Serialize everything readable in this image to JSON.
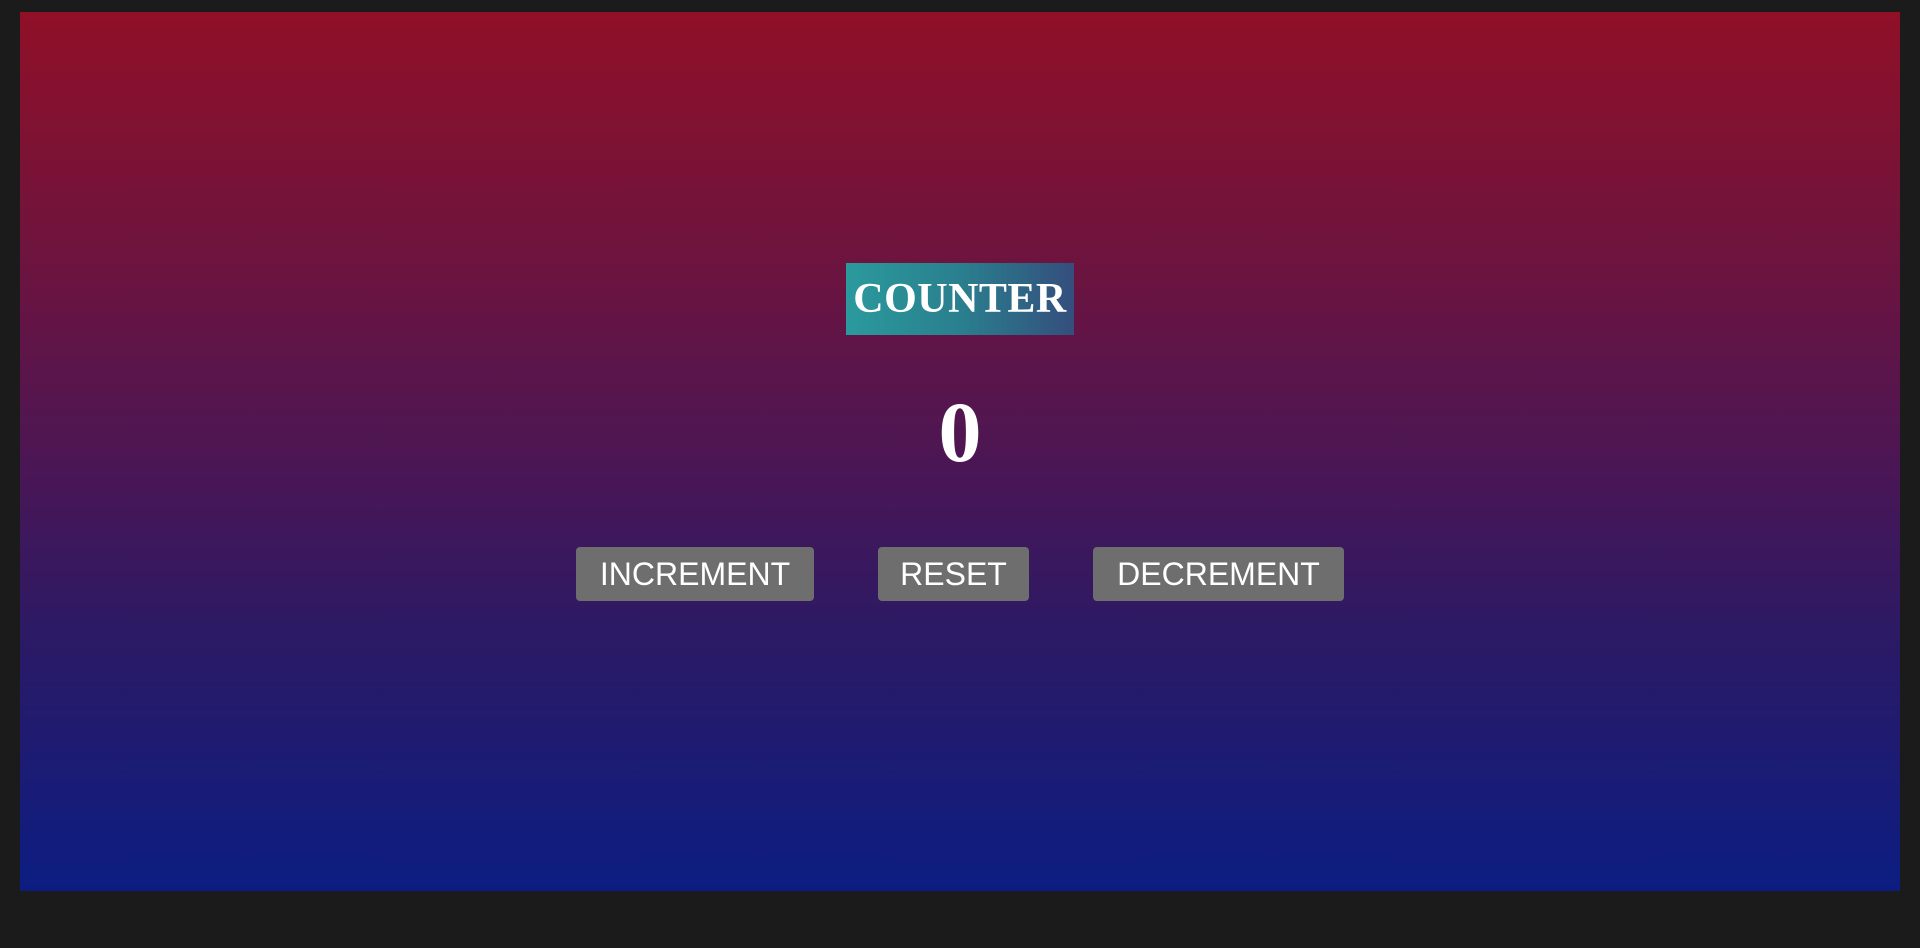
{
  "counter": {
    "title": "COUNTER",
    "value": "0"
  },
  "buttons": {
    "increment": "INCREMENT",
    "reset": "RESET",
    "decrement": "DECREMENT"
  },
  "colors": {
    "page_background": "#1b1b1b",
    "gradient_top": "#901027",
    "gradient_bottom": "#0c1d82",
    "title_gradient_start": "#2a9a9d",
    "title_gradient_end": "#344e7d",
    "button_background": "#6e6e6e",
    "text": "#ffffff"
  }
}
